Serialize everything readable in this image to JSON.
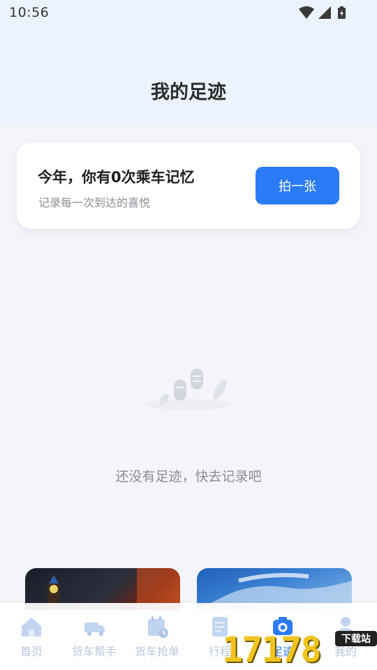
{
  "status_bar": {
    "time": "10:56",
    "icons": [
      "wifi-icon",
      "signal-icon",
      "battery-charging-icon"
    ]
  },
  "header": {
    "title": "我的足迹"
  },
  "memory_card": {
    "title": "今年，你有0次乘车记忆",
    "subtitle": "记录每一次到达的喜悦",
    "button_label": "拍一张"
  },
  "empty_state": {
    "icon": "footprints-icon",
    "message": "还没有足迹，快去记录吧"
  },
  "tabbar": {
    "items": [
      {
        "label": "首页",
        "icon": "home-icon"
      },
      {
        "label": "货车帮手",
        "icon": "truck-icon"
      },
      {
        "label": "货车抢单",
        "icon": "calendar-clock-icon"
      },
      {
        "label": "行程",
        "icon": "document-icon"
      },
      {
        "label": "足迹",
        "icon": "camera-icon",
        "active": true
      },
      {
        "label": "我的",
        "icon": "person-icon"
      }
    ]
  },
  "watermark": {
    "digits": "17178",
    "badge": "下载站"
  },
  "colors": {
    "accent": "#2b7bf6",
    "header_bg": "#eaf3fe",
    "page_bg": "#f4f5f9",
    "tab_inactive": "#b8c6dc"
  }
}
